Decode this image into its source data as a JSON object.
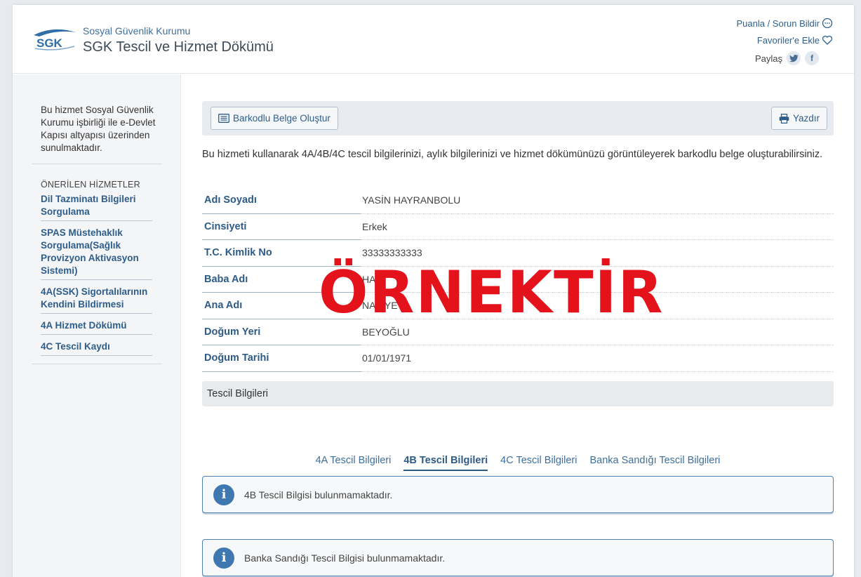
{
  "header": {
    "org_name": "Sosyal Güvenlik Kurumu",
    "service_title": "SGK Tescil ve Hizmet Dökümü",
    "logo_text": "SGK",
    "rate_link": "Puanla / Sorun Bildir",
    "favorite_link": "Favoriler'e Ekle",
    "share_label": "Paylaş",
    "twitter_icon": "twitter-icon",
    "facebook_icon": "facebook-icon"
  },
  "sidebar": {
    "info": "Bu hizmet Sosyal Güvenlik Kurumu işbirliği ile e-Devlet Kapısı altyapısı üzerinden sunulmaktadır.",
    "section_title": "ÖNERİLEN HİZMETLER",
    "items": [
      {
        "label": "Dil Tazminatı Bilgileri Sorgulama"
      },
      {
        "label": "SPAS Müstehaklık Sorgulama(Sağlık Provizyon Aktivasyon Sistemi)"
      },
      {
        "label": "4A(SSK) Sigortalılarının Kendini Bildirmesi"
      },
      {
        "label": "4A Hizmet Dökümü"
      },
      {
        "label": "4C Tescil Kaydı"
      }
    ]
  },
  "toolbar": {
    "barcode_button": "Barkodlu Belge Oluştur",
    "print_button": "Yazdır"
  },
  "intro": "Bu hizmeti kullanarak 4A/4B/4C tescil bilgilerinizi, aylık bilgilerinizi ve hizmet dökümünüzü görüntüleyerek barkodlu belge oluşturabilirsiniz.",
  "person": [
    {
      "key": "Adı Soyadı",
      "value": "YASİN HAYRANBOLU"
    },
    {
      "key": "Cinsiyeti",
      "value": "Erkek"
    },
    {
      "key": "T.C. Kimlik No",
      "value": "33333333333"
    },
    {
      "key": "Baba Adı",
      "value": "HALİ"
    },
    {
      "key": "Ana Adı",
      "value": "NAZİYE"
    },
    {
      "key": "Doğum Yeri",
      "value": "BEYOĞLU"
    },
    {
      "key": "Doğum Tarihi",
      "value": "01/01/1971"
    }
  ],
  "watermark": "ÖRNEKTİR",
  "section_title": "Tescil Bilgileri",
  "tabs": [
    {
      "label": "4A Tescil Bilgileri",
      "active": false
    },
    {
      "label": "4B Tescil Bilgileri",
      "active": true
    },
    {
      "label": "4C Tescil Bilgileri",
      "active": false
    },
    {
      "label": "Banka Sandığı Tescil Bilgileri",
      "active": false
    }
  ],
  "alerts": [
    {
      "text": "4B Tescil Bilgisi bulunmamaktadır."
    },
    {
      "text": "Banka Sandığı Tescil Bilgisi bulunmamaktadır."
    }
  ],
  "colors": {
    "brand": "#2d5b86",
    "watermark": "#e4121b",
    "alert_border": "#4b81b3"
  }
}
